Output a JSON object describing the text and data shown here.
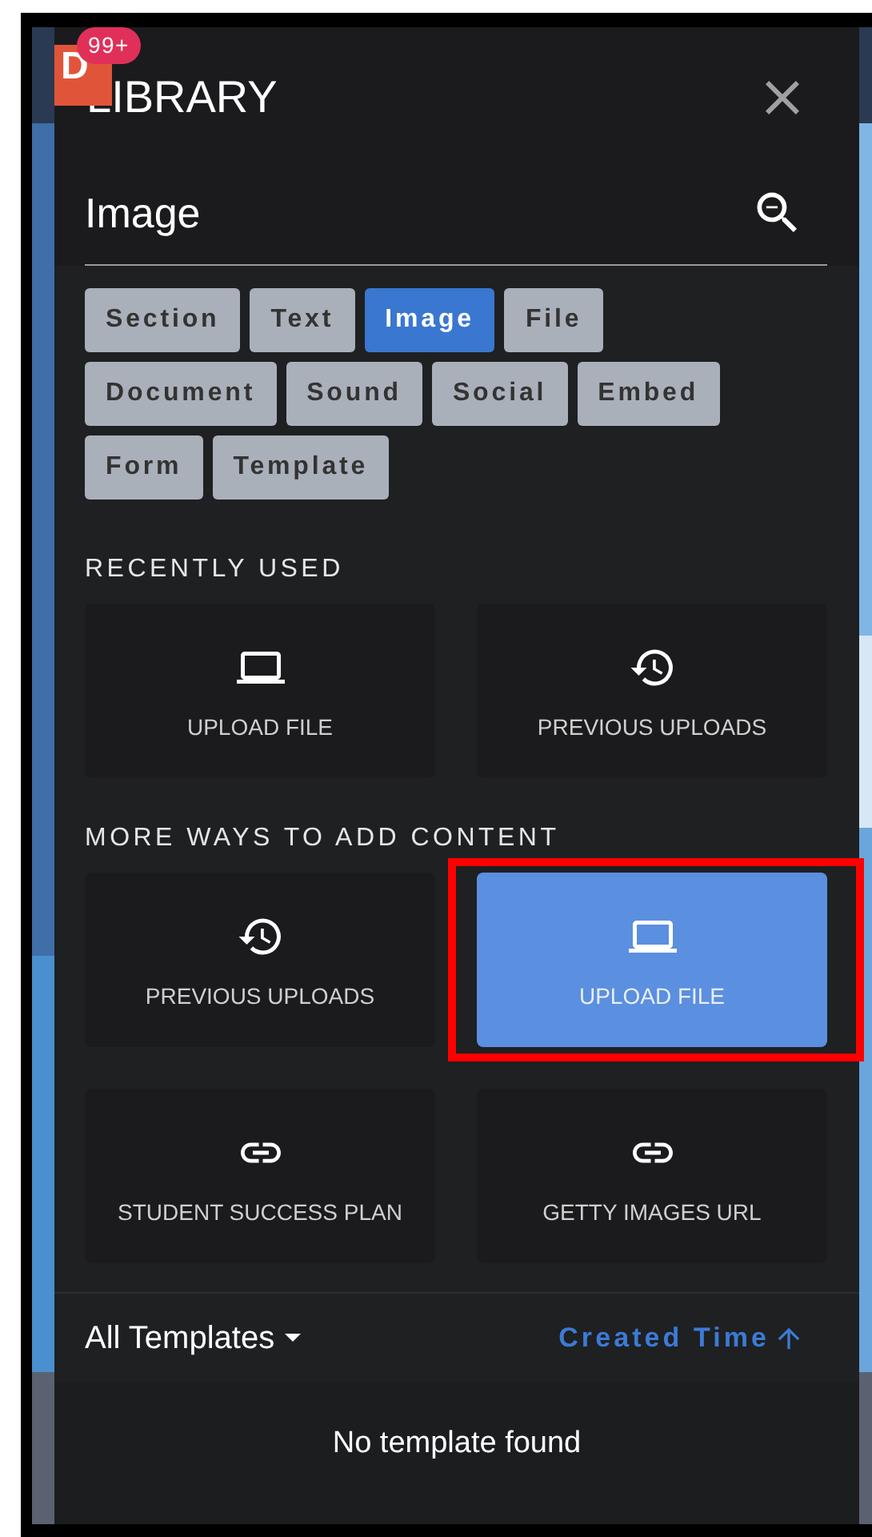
{
  "header": {
    "badge_letter": "D",
    "badge_count": "99+",
    "title": "LIBRARY"
  },
  "search": {
    "value": "Image"
  },
  "filters": [
    {
      "label": "Section",
      "selected": false
    },
    {
      "label": "Text",
      "selected": false
    },
    {
      "label": "Image",
      "selected": true
    },
    {
      "label": "File",
      "selected": false
    },
    {
      "label": "Document",
      "selected": false
    },
    {
      "label": "Sound",
      "selected": false
    },
    {
      "label": "Social",
      "selected": false
    },
    {
      "label": "Embed",
      "selected": false
    },
    {
      "label": "Form",
      "selected": false
    },
    {
      "label": "Template",
      "selected": false
    }
  ],
  "sections": [
    {
      "title": "RECENTLY USED",
      "tiles": [
        {
          "label": "UPLOAD FILE",
          "kind": "laptop",
          "selected": false,
          "annotated": false
        },
        {
          "label": "PREVIOUS UPLOADS",
          "kind": "history",
          "selected": false,
          "annotated": false
        }
      ]
    },
    {
      "title": "MORE WAYS TO ADD CONTENT",
      "tiles": [
        {
          "label": "PREVIOUS UPLOADS",
          "kind": "history",
          "selected": false,
          "annotated": false
        },
        {
          "label": "UPLOAD FILE",
          "kind": "laptop",
          "selected": true,
          "annotated": true
        },
        {
          "label": "STUDENT SUCCESS PLAN",
          "kind": "link",
          "selected": false,
          "annotated": false
        },
        {
          "label": "GETTY IMAGES URL",
          "kind": "link",
          "selected": false,
          "annotated": false
        }
      ]
    }
  ],
  "templates": {
    "filter": "All Templates",
    "sort": "Created Time",
    "empty_message": "No template found"
  }
}
